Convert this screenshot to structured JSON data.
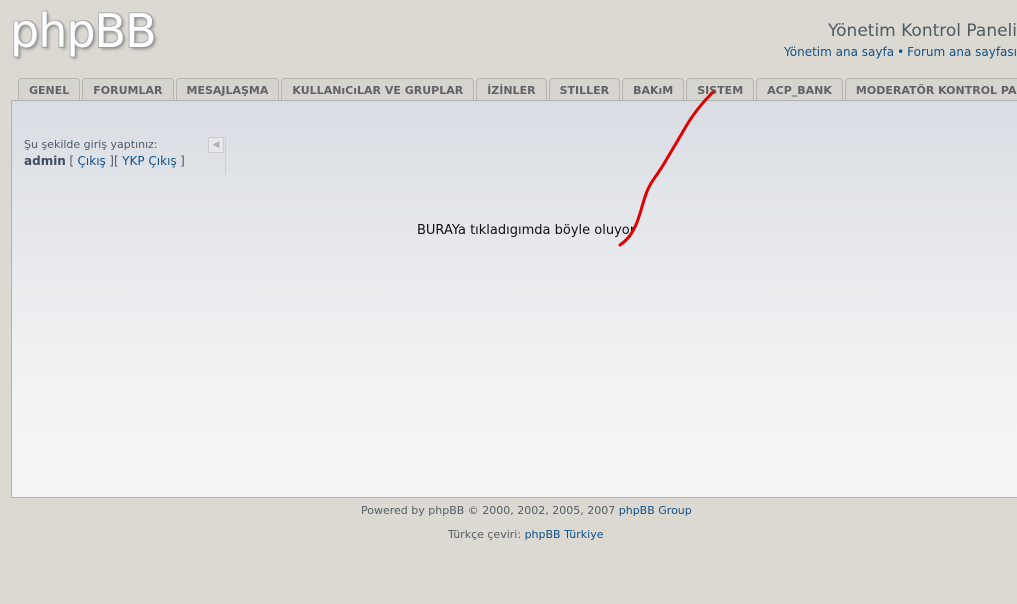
{
  "logo": {
    "text": "phpBB"
  },
  "header": {
    "title": "Yönetim Kontrol Paneli",
    "links": [
      {
        "label": "Yönetim ana sayfa"
      },
      {
        "label": "Forum ana sayfası"
      }
    ],
    "separator": "•"
  },
  "tabs": [
    {
      "label": "GENEL"
    },
    {
      "label": "FORUMLAR"
    },
    {
      "label": "MESAJLAŞMA"
    },
    {
      "label": "KULLANıCıLAR VE GRUPLAR"
    },
    {
      "label": "İZİNLER"
    },
    {
      "label": "STILLER"
    },
    {
      "label": "BAKıM"
    },
    {
      "label": "SISTEM"
    },
    {
      "label": "ACP_BANK"
    },
    {
      "label": "MODERATÖR KONTROL PANELI"
    }
  ],
  "login": {
    "prompt": "Şu şekilde giriş yaptınız:",
    "username": "admin",
    "open_bracket": "[",
    "logout_label": "Çıkış",
    "middle_bracket": "][",
    "ykp_logout_label": "YKP Çıkış",
    "close_bracket": "]"
  },
  "collapse_icon": {
    "glyph": "◀"
  },
  "annotation": {
    "text": "BURAYa tıkladıgımda böyle oluyor",
    "stroke_color": "#e00000"
  },
  "footer": {
    "powered_prefix": "Powered by phpBB © 2000, 2002, 2005, 2007",
    "group_link": "phpBB Group",
    "translation_prefix": "Türkçe çeviri:",
    "translation_link": "phpBB Türkiye"
  }
}
